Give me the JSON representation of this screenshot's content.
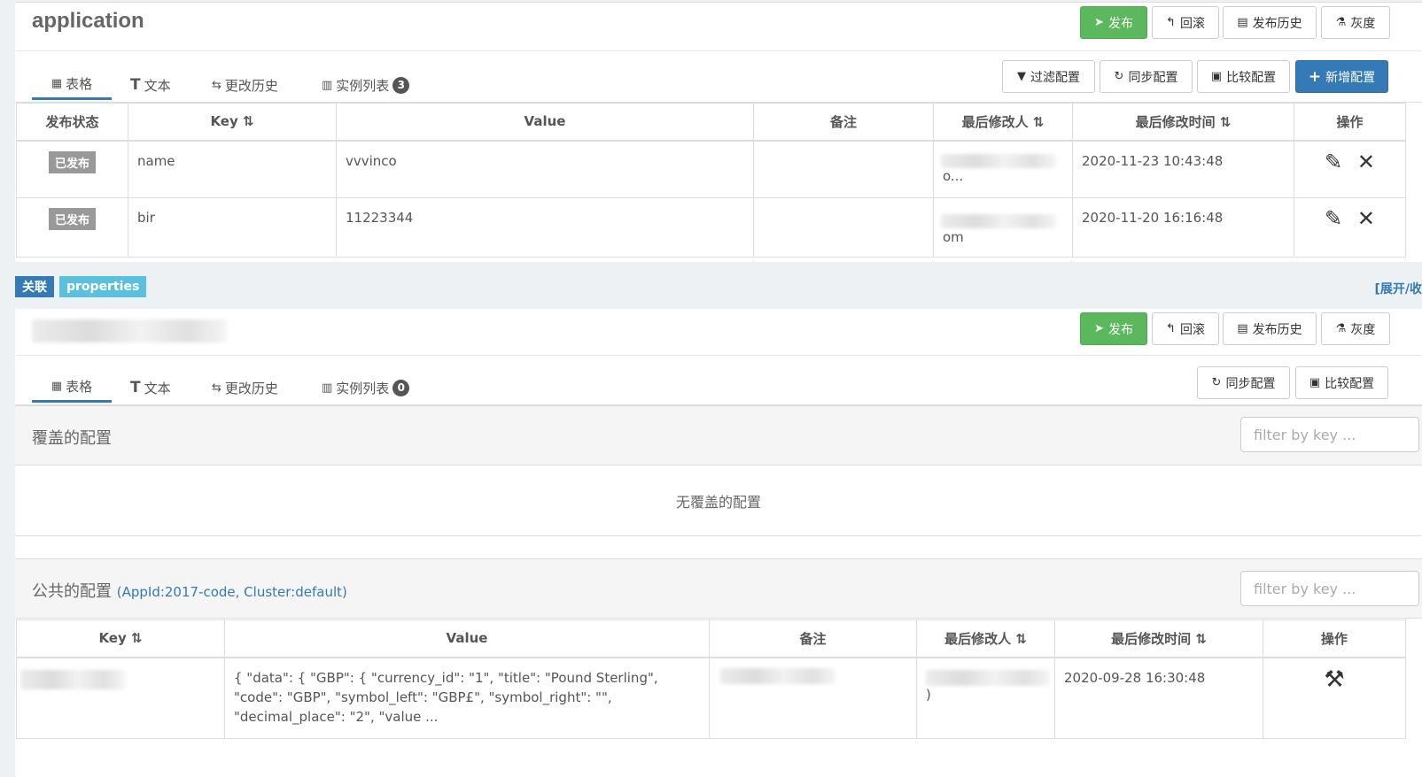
{
  "namespace1": {
    "title": "application",
    "actions": {
      "publish": "发布",
      "rollback": "回滚",
      "history": "发布历史",
      "gray": "灰度"
    },
    "tabs": {
      "table": "表格",
      "text": "文本",
      "history": "更改历史",
      "instances": "实例列表",
      "instances_count": "3"
    },
    "tools": {
      "filter": "过滤配置",
      "sync": "同步配置",
      "compare": "比较配置",
      "add": "新增配置"
    },
    "columns": {
      "status": "发布状态",
      "key": "Key",
      "value": "Value",
      "comment": "备注",
      "modifier": "最后修改人",
      "modified_time": "最后修改时间",
      "ops": "操作"
    },
    "rows": [
      {
        "status": "已发布",
        "key": "name",
        "value": "vvvinco",
        "comment": "",
        "modifier_tail": "o...",
        "time": "2020-11-23 10:43:48"
      },
      {
        "status": "已发布",
        "key": "bir",
        "value": "11223344",
        "comment": "",
        "modifier_tail": "om",
        "time": "2020-11-20 16:16:48"
      }
    ]
  },
  "labels": {
    "link": "关联",
    "format": "properties",
    "expand": "[展开/收"
  },
  "namespace2": {
    "actions": {
      "publish": "发布",
      "rollback": "回滚",
      "history": "发布历史",
      "gray": "灰度"
    },
    "tabs": {
      "table": "表格",
      "text": "文本",
      "history": "更改历史",
      "instances": "实例列表",
      "instances_count": "0"
    },
    "tools": {
      "sync": "同步配置",
      "compare": "比较配置"
    },
    "override": {
      "title": "覆盖的配置",
      "filter_placeholder": "filter by key ...",
      "empty": "无覆盖的配置"
    },
    "public": {
      "title": "公共的配置",
      "subtitle": "(AppId:2017-code, Cluster:default)",
      "filter_placeholder": "filter by key ...",
      "columns": {
        "key": "Key",
        "value": "Value",
        "comment": "备注",
        "modifier": "最后修改人",
        "modified_time": "最后修改时间",
        "ops": "操作"
      },
      "rows": [
        {
          "key": "",
          "value": "{ \"data\": { \"GBP\": { \"currency_id\": \"1\", \"title\": \"Pound Sterling\", \"code\": \"GBP\", \"symbol_left\": \"GBP£\", \"symbol_right\": \"\", \"decimal_place\": \"2\", \"value ...",
          "comment": "",
          "modifier_tail": ")",
          "time": "2020-09-28 16:30:48"
        }
      ]
    }
  },
  "icons": {
    "publish": "paper-plane-icon",
    "rollback": "undo-icon",
    "history": "calendar-icon",
    "gray": "flask-icon",
    "filter": "funnel-icon",
    "sync": "refresh-icon",
    "compare": "clipboard-icon",
    "add": "plus-icon",
    "edit": "edit-icon",
    "delete": "close-icon",
    "override": "wrench-icon",
    "sort": "sort-icon"
  },
  "colors": {
    "primary": "#337ab7",
    "success": "#5cb85c",
    "info": "#5bc0de",
    "published_tag": "#999999"
  }
}
